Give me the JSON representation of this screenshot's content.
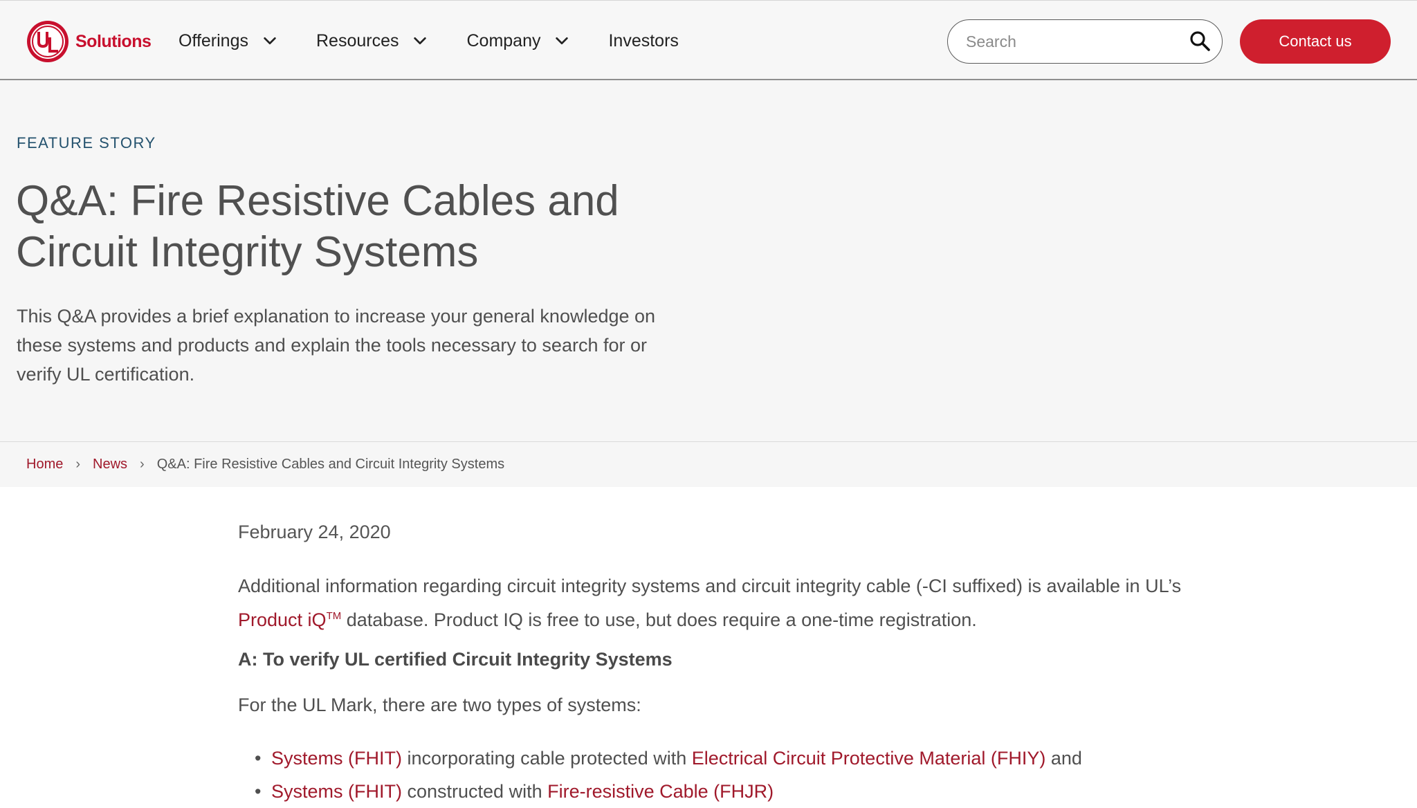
{
  "header": {
    "logo_text": "Solutions",
    "logo_mark": "UL",
    "nav": [
      {
        "label": "Offerings",
        "has_dropdown": true
      },
      {
        "label": "Resources",
        "has_dropdown": true
      },
      {
        "label": "Company",
        "has_dropdown": true
      },
      {
        "label": "Investors",
        "has_dropdown": false
      }
    ],
    "search_placeholder": "Search",
    "contact_label": "Contact us"
  },
  "hero": {
    "eyebrow": "FEATURE STORY",
    "title_line1": "Q&A: Fire Resistive Cables and",
    "title_line2": "Circuit Integrity Systems",
    "description": "This Q&A provides a brief explanation to increase your general knowledge on these systems and products and explain the tools necessary to search for or verify UL certification."
  },
  "breadcrumb": {
    "home": "Home",
    "news": "News",
    "sep": "›",
    "current": "Q&A: Fire Resistive Cables and Circuit Integrity Systems"
  },
  "article": {
    "date": "February 24, 2020",
    "para1_before": "Additional information regarding circuit integrity systems and circuit integrity cable (-CI suffixed) is available in UL’s ",
    "para1_link": "Product iQ",
    "para1_tm": "TM",
    "para1_after": " database.  Product IQ is free to use, but does require a one-time registration.",
    "subhead": "A: To verify UL certified Circuit Integrity Systems",
    "para2": "For the UL Mark, there are two types of systems:",
    "bullets": [
      {
        "link1": "Systems (FHIT)",
        "text1": " incorporating cable protected with ",
        "link2": "Electrical Circuit Protective Material (FHIY)",
        "text2": " and"
      },
      {
        "link1": "Systems (FHIT)",
        "text1": " constructed with ",
        "link2": "Fire-resistive Cable (FHJR)",
        "text2": ""
      }
    ],
    "bullet_char": "•"
  },
  "colors": {
    "brand_red": "#cf1f2e",
    "link_red": "#a0192b",
    "eyebrow_blue": "#24526e",
    "hero_bg": "#f6f6f6"
  },
  "icons": [
    "ul-logo-icon",
    "chevron-down-icon",
    "search-icon"
  ]
}
